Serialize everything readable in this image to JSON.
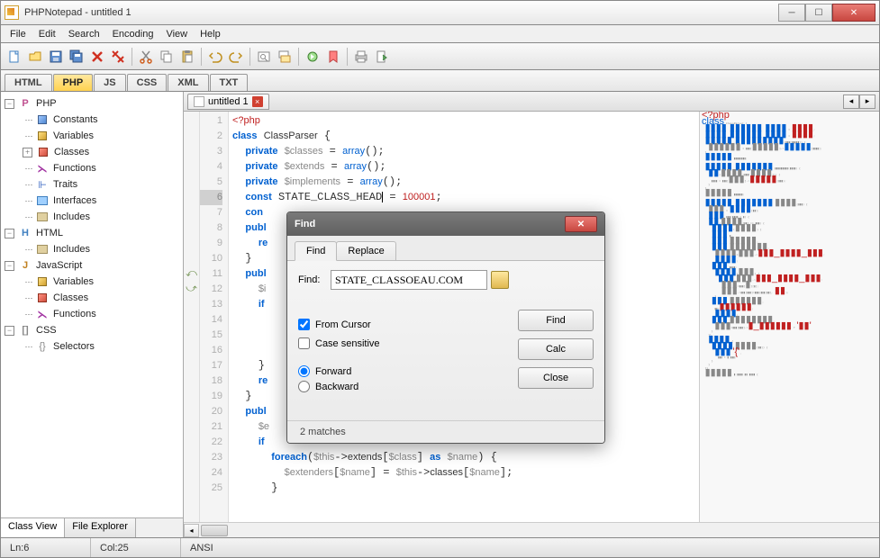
{
  "window": {
    "title": "PHPNotepad - untitled 1"
  },
  "menu": [
    "File",
    "Edit",
    "Search",
    "Encoding",
    "View",
    "Help"
  ],
  "lang_tabs": [
    "HTML",
    "PHP",
    "JS",
    "CSS",
    "XML",
    "TXT"
  ],
  "active_lang": "PHP",
  "tree": {
    "php": {
      "label": "PHP",
      "children": [
        {
          "label": "Constants",
          "icon": "cube-b"
        },
        {
          "label": "Variables",
          "icon": "cube-y"
        },
        {
          "label": "Classes",
          "icon": "cube-r",
          "expandable": true
        },
        {
          "label": "Functions",
          "icon": "func"
        },
        {
          "label": "Traits",
          "icon": "trait"
        },
        {
          "label": "Interfaces",
          "icon": "iface"
        },
        {
          "label": "Includes",
          "icon": "inc"
        }
      ]
    },
    "html": {
      "label": "HTML",
      "children": [
        {
          "label": "Includes",
          "icon": "inc"
        }
      ]
    },
    "js": {
      "label": "JavaScript",
      "children": [
        {
          "label": "Variables",
          "icon": "cube-y"
        },
        {
          "label": "Classes",
          "icon": "cube-r"
        },
        {
          "label": "Functions",
          "icon": "func"
        }
      ]
    },
    "css": {
      "label": "CSS",
      "children": [
        {
          "label": "Selectors",
          "icon": "sel"
        }
      ]
    }
  },
  "side_tabs": [
    "Class View",
    "File Explorer"
  ],
  "active_side_tab": "Class View",
  "editor_tab": {
    "name": "untitled 1"
  },
  "code_lines": [
    "<?php",
    "class ClassParser {",
    "  private $classes = array();",
    "  private $extends = array();",
    "  private $implements = array();",
    "  const STATE_CLASS_HEAD = 100001;",
    "  con",
    "  publ",
    "    re",
    "  }",
    "  publ",
    "    $i",
    "    if",
    "",
    "",
    "",
    "    }",
    "    re",
    "  }",
    "  publ",
    "    $e",
    "    if",
    "      foreach($this->extends[$class] as $name) {",
    "        $extenders[$name] = $this->classes[$name];",
    "      }"
  ],
  "find": {
    "title": "Find",
    "tabs": [
      "Find",
      "Replace"
    ],
    "active_tab": "Find",
    "label": "Find:",
    "value": "STATE_CLASSOEAU.COM",
    "from_cursor": "From Cursor",
    "case_sensitive": "Case sensitive",
    "forward": "Forward",
    "backward": "Backward",
    "from_cursor_checked": true,
    "forward_checked": true,
    "btn_find": "Find",
    "btn_calc": "Calc",
    "btn_close": "Close",
    "status": "2 matches"
  },
  "status": {
    "ln": "Ln:6",
    "col": "Col:25",
    "enc": "ANSI"
  }
}
